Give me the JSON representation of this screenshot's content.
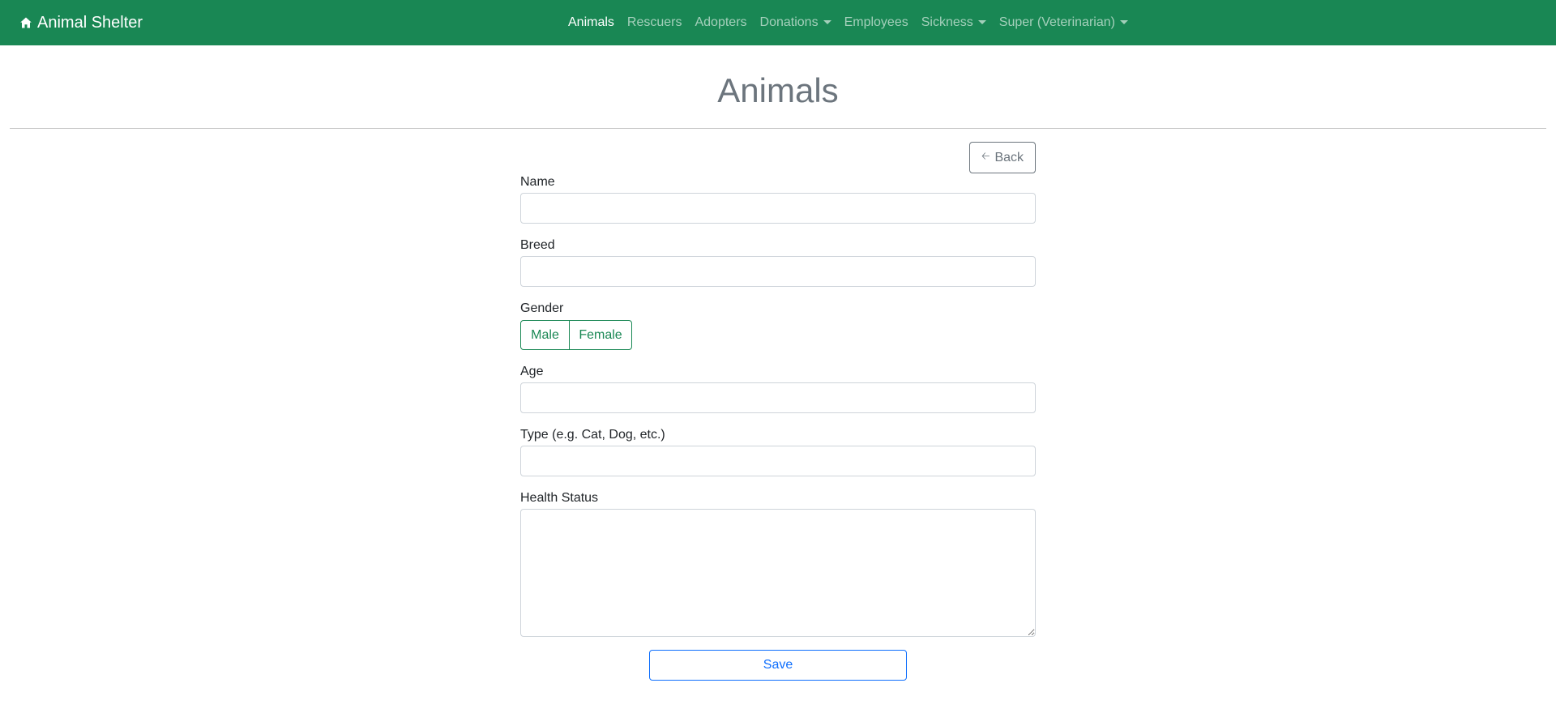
{
  "navbar": {
    "brand_icon": "home-icon",
    "brand": "Animal Shelter",
    "background_color": "#198754",
    "items": [
      {
        "label": "Animals",
        "active": true,
        "dropdown": false
      },
      {
        "label": "Rescuers",
        "active": false,
        "dropdown": false
      },
      {
        "label": "Adopters",
        "active": false,
        "dropdown": false
      },
      {
        "label": "Donations",
        "active": false,
        "dropdown": true
      },
      {
        "label": "Employees",
        "active": false,
        "dropdown": false
      },
      {
        "label": "Sickness",
        "active": false,
        "dropdown": true
      },
      {
        "label": "Super (Veterinarian)",
        "active": false,
        "dropdown": true
      }
    ]
  },
  "page": {
    "title": "Animals"
  },
  "form": {
    "back_icon": "arrow-left-icon",
    "back_label": "Back",
    "name_label": "Name",
    "name_value": "",
    "breed_label": "Breed",
    "breed_value": "",
    "gender_label": "Gender",
    "gender_options": [
      "Male",
      "Female"
    ],
    "age_label": "Age",
    "age_value": "",
    "type_label": "Type (e.g. Cat, Dog, etc.)",
    "type_value": "",
    "health_label": "Health Status",
    "health_value": "",
    "save_label": "Save"
  },
  "colors": {
    "primary": "#0d6efd",
    "success": "#198754",
    "secondary": "#6c757d"
  }
}
